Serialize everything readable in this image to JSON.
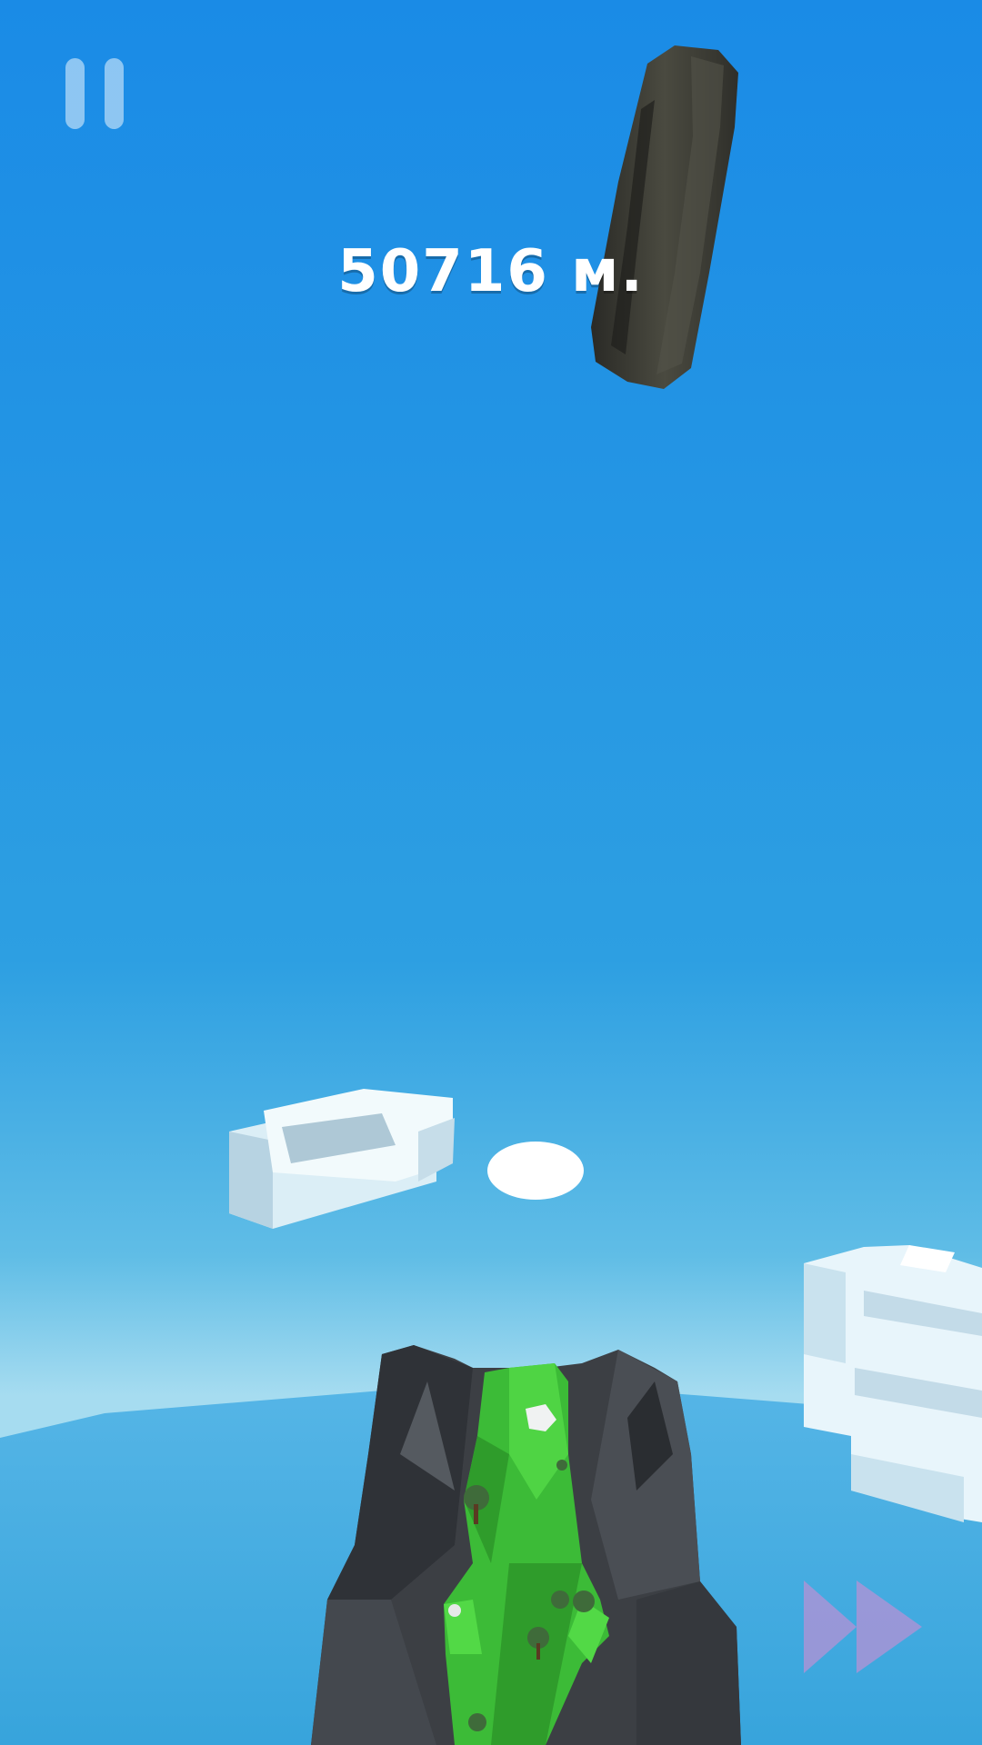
{
  "hud": {
    "distance_text": "50716 м.",
    "pause_icon": "pause-icon",
    "fast_forward_icon": "fast-forward-icon"
  },
  "colors": {
    "sky_top": "#1a8fe6",
    "sky_mid": "#33a6e4",
    "horizon": "#9cd6ee",
    "sea": "#3aa8e0",
    "rock": "#3f4247",
    "grass": "#3fbf3a",
    "cloud": "#e8f4fa",
    "fast_forward": "#a894d6"
  }
}
